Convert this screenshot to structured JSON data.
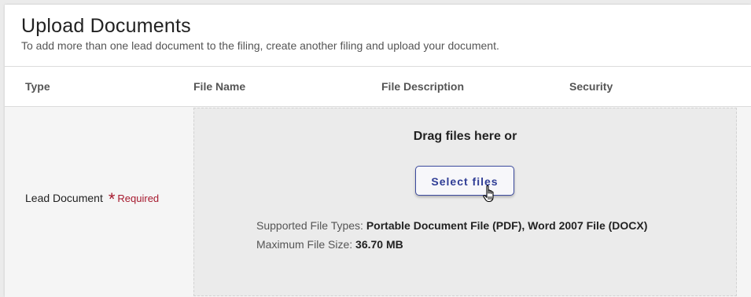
{
  "header": {
    "title": "Upload Documents",
    "subtitle": "To add more than one lead document to the filing, create another filing and upload your document."
  },
  "table": {
    "columns": [
      "Type",
      "File Name",
      "File Description",
      "Security"
    ],
    "row": {
      "type_label": "Lead Document",
      "required_marker": "*",
      "required_label": "Required"
    }
  },
  "dropzone": {
    "drag_text": "Drag files here or",
    "select_button_label": "Select files",
    "supported_types_label": "Supported File Types:",
    "supported_types_value": "Portable Document File (PDF), Word 2007 File (DOCX)",
    "max_size_label": "Maximum File Size:",
    "max_size_value": "36.70 MB"
  },
  "colors": {
    "required": "#a6192e",
    "button_text": "#2f3d95",
    "dropzone_bg": "#ebebeb"
  },
  "icons": {
    "cursor": "hand-pointer-icon"
  }
}
